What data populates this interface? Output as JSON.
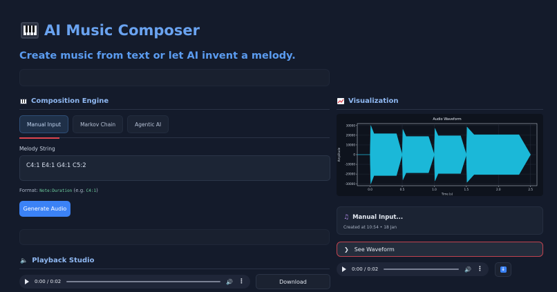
{
  "header": {
    "title": "AI Music Composer",
    "subtitle": "Create music from text or let AI invent a melody."
  },
  "composition": {
    "heading": "Composition Engine",
    "tabs": [
      {
        "label": "Manual Input",
        "active": true
      },
      {
        "label": "Markov Chain",
        "active": false
      },
      {
        "label": "Agentic AI",
        "active": false
      }
    ],
    "melody_label": "Melody String",
    "melody_value": "C4:1 E4:1 G4:1 C5:2",
    "format_prefix": "Format:",
    "format_code": "Note:Duration",
    "format_eg": "(e.g.",
    "format_eg_code": "C4:1",
    "format_suffix": ")",
    "generate_label": "Generate Audio"
  },
  "playback": {
    "heading": "Playback Studio",
    "time": "0:00 / 0:02",
    "download_label": "Download"
  },
  "visualization": {
    "heading": "Visualization",
    "card_title": "Manual Input...",
    "card_subtitle": "Created at 10:54 • 18 Jan",
    "expander_label": "See Waveform",
    "player_time": "0:00 / 0:02"
  },
  "chart_data": {
    "type": "area",
    "title": "Audio Waveform",
    "xlabel": "Time (s)",
    "ylabel": "Amplitude",
    "xlim": [
      -0.2,
      2.6
    ],
    "ylim": [
      -32000,
      32000
    ],
    "xticks": [
      "0.0",
      "0.5",
      "1.0",
      "1.5",
      "2.0",
      "2.5"
    ],
    "yticks": [
      "30000",
      "20000",
      "10000",
      "0",
      "-10000",
      "-20000",
      "-30000"
    ],
    "series": [
      {
        "notes": [
          {
            "start": 0.0,
            "end": 0.5,
            "peak": 30000
          },
          {
            "start": 0.5,
            "end": 1.0,
            "peak": 26000
          },
          {
            "start": 1.0,
            "end": 1.5,
            "peak": 27000
          },
          {
            "start": 1.5,
            "end": 2.5,
            "peak": 28500
          }
        ]
      }
    ],
    "color": "#1bb8d8",
    "grid": true
  }
}
